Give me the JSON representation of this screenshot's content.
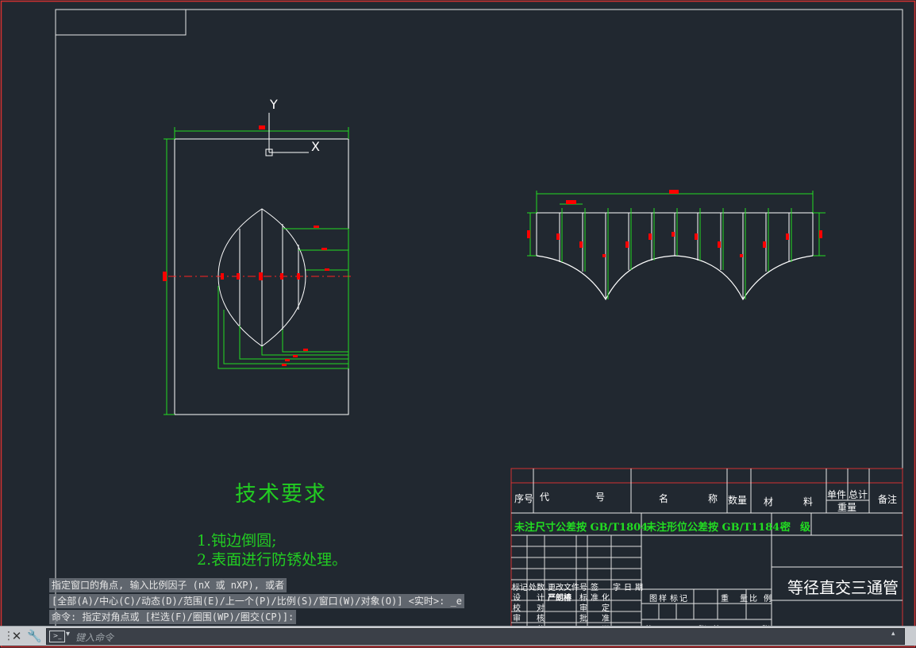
{
  "ucs": {
    "x_label": "X",
    "y_label": "Y"
  },
  "tech_requirements": {
    "title": "技术要求",
    "items": [
      "1.钝边倒圆;",
      "2.表面进行防锈处理。"
    ]
  },
  "command_line": {
    "history": [
      "指定窗口的角点, 输入比例因子 (nX 或 nXP), 或者",
      "[全部(A)/中心(C)/动态(D)/范围(E)/上一个(P)/比例(S)/窗口(W)/对象(O)] <实时>: _e",
      "命令: 指定对角点或 [栏选(F)/圈围(WP)/圈交(CP)]:"
    ],
    "placeholder": "键入命令",
    "close_icon": "close-icon",
    "customize_icon": "wrench-icon",
    "prompt_icon": "command-prompt-icon"
  },
  "title_block": {
    "headers": {
      "seq": "序号",
      "code_a": "代",
      "code_b": "号",
      "name_a": "名",
      "name_b": "称",
      "qty": "数量",
      "material_a": "材",
      "material_b": "料",
      "unit_weight": "单件",
      "total_weight": "总计",
      "weight": "重量",
      "remark": "备注"
    },
    "tolerance_dim": "未注尺寸公差按 GB/T1804-",
    "tolerance_geo": "未注形位公差按 GB/T1184-",
    "secret_a": "密",
    "secret_b": "级",
    "part_name": "等径直交三通管",
    "rev_row": [
      "标记",
      "处数",
      "更改文件号",
      "签",
      "字",
      "日",
      "期"
    ],
    "sign_rows": [
      [
        "设",
        "计",
        "严朗椿",
        "标",
        "准",
        "化"
      ],
      [
        "校",
        "对",
        "审",
        "定"
      ],
      [
        "审",
        "核",
        "批",
        "准"
      ],
      [
        "工",
        "艺",
        "日",
        "期"
      ]
    ],
    "stage_row": [
      "图",
      "样",
      "标",
      "记",
      "重",
      "量",
      "比",
      "例"
    ],
    "sheet_row": [
      "共",
      "张",
      "第",
      "张"
    ]
  },
  "colors": {
    "background": "#212830",
    "geometry": "#ffffff",
    "dimension": "#22dd22",
    "marker": "#ff0000",
    "border": "#ff3333"
  }
}
